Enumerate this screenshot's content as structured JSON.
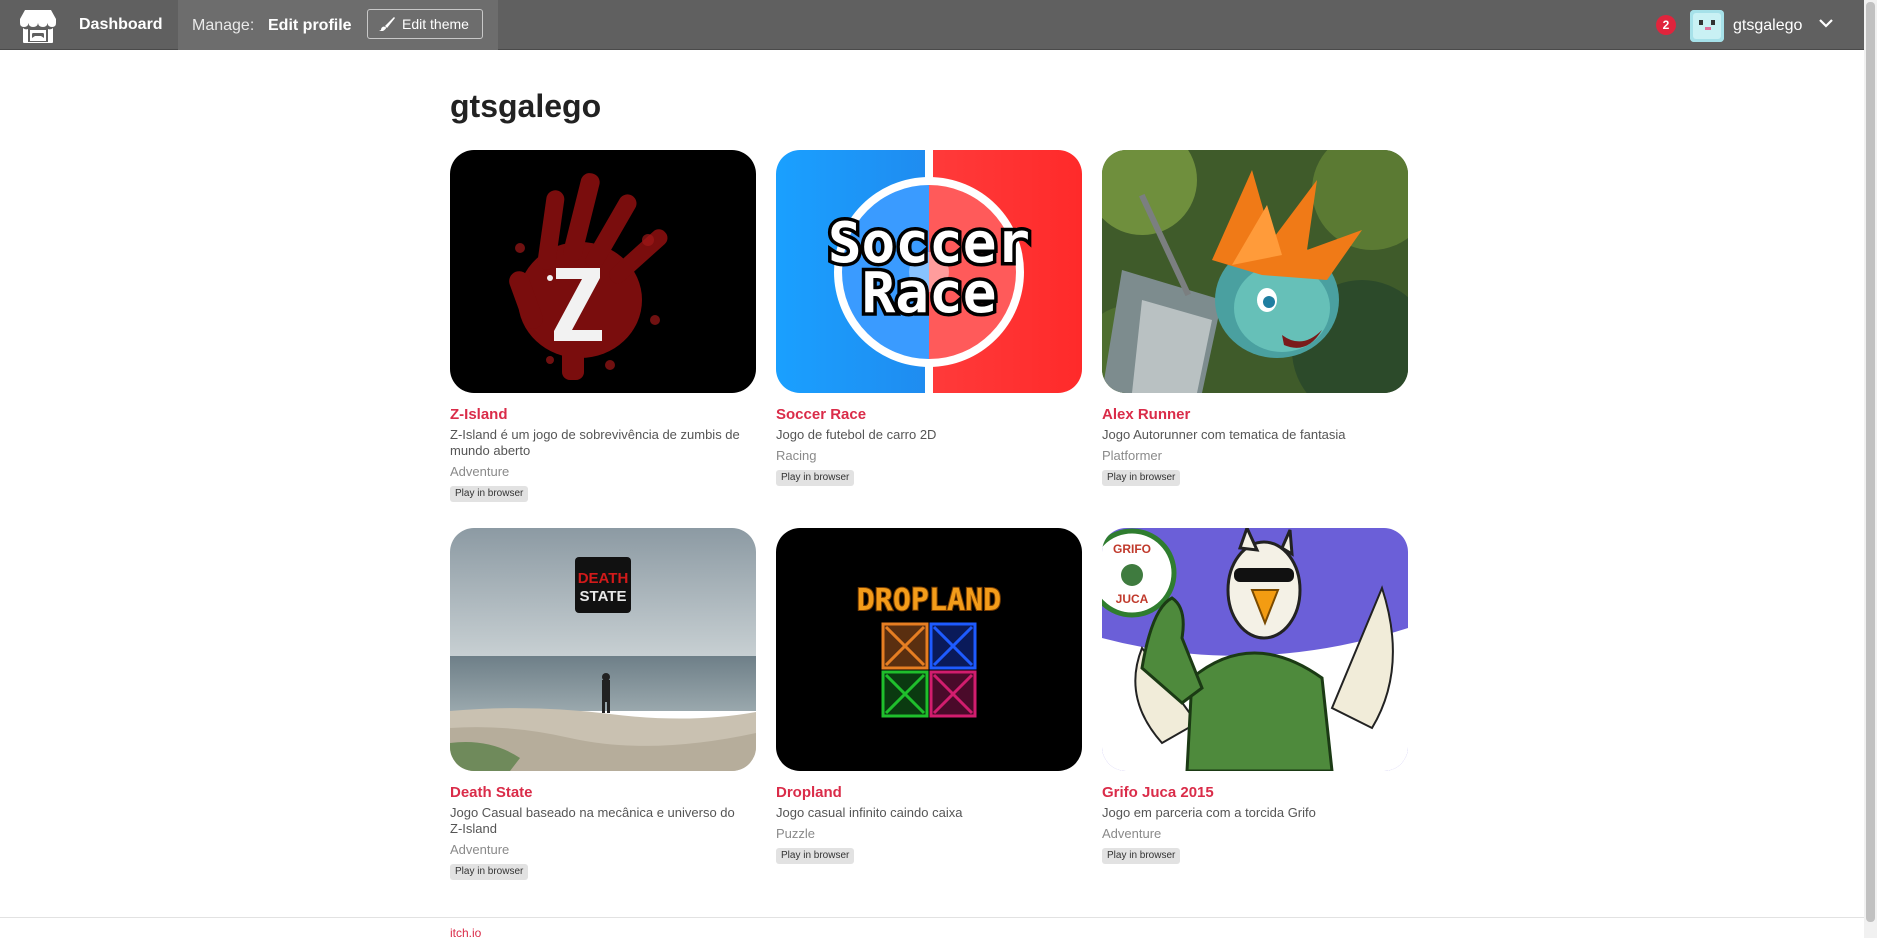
{
  "topbar": {
    "logo_icon": "itchio-logo-icon",
    "dashboard_label": "Dashboard",
    "manage_label": "Manage:",
    "edit_profile_label": "Edit profile",
    "edit_theme_label": "Edit theme",
    "edit_theme_icon": "paintbrush-icon",
    "notification_count": "2",
    "username": "gtsgalego",
    "menu_icon": "chevron-down-icon"
  },
  "profile": {
    "title": "gtsgalego"
  },
  "games": [
    {
      "title": "Z-Island",
      "description": "Z-Island é um jogo de sobrevivência de zumbis de mundo aberto",
      "genre": "Adventure",
      "tag": "Play in browser"
    },
    {
      "title": "Soccer Race",
      "description": "Jogo de futebol de carro 2D",
      "genre": "Racing",
      "tag": "Play in browser",
      "cover_text_line1": "Soccer",
      "cover_text_line2": "Race"
    },
    {
      "title": "Alex Runner",
      "description": "Jogo Autorunner com tematica de fantasia",
      "genre": "Platformer",
      "tag": "Play in browser"
    },
    {
      "title": "Death State",
      "description": "Jogo Casual baseado na mecânica e universo do Z-Island",
      "genre": "Adventure",
      "tag": "Play in browser",
      "cover_text_line1": "DEATH",
      "cover_text_line2": "STATE"
    },
    {
      "title": "Dropland",
      "description": "Jogo casual infinito caindo caixa",
      "genre": "Puzzle",
      "tag": "Play in browser",
      "cover_text_line1": "DROPLAND"
    },
    {
      "title": "Grifo Juca 2015",
      "description": "Jogo em parceria com a torcida Grifo",
      "genre": "Adventure",
      "tag": "Play in browser",
      "cover_text_line1": "GRIFO",
      "cover_text_line2": "JUCA"
    }
  ],
  "footer": {
    "link_label": "itch.io"
  },
  "colors": {
    "topbar_bg": "#606060",
    "accent": "#da2c49",
    "badge": "#e0243c"
  }
}
